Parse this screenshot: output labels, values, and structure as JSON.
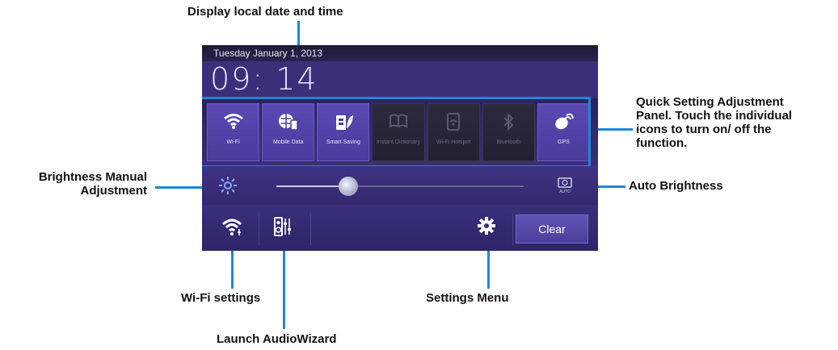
{
  "callouts": {
    "datetime": "Display local date and time",
    "quick_settings": [
      "Quick Setting Adjustment",
      "Panel. Touch the individual",
      "icons to turn on/ off the",
      "function."
    ],
    "brightness_manual": [
      "Brightness Manual",
      "Adjustment"
    ],
    "auto_brightness": "Auto Brightness",
    "wifi_settings": "Wi-Fi settings",
    "settings_menu": "Settings Menu",
    "audiowizard": "Launch AudioWizard"
  },
  "panel": {
    "date": "Tuesday January 1, 2013",
    "time": "09: 14",
    "tiles": [
      {
        "label": "Wi-Fi",
        "icon": "wifi-icon",
        "on": true
      },
      {
        "label": "Mobile Data",
        "icon": "mobile-data-icon",
        "on": true
      },
      {
        "label": "Smart Saving",
        "icon": "smart-saving-icon",
        "on": true
      },
      {
        "label": "Instant Dictionary",
        "icon": "dictionary-icon",
        "on": false
      },
      {
        "label": "Wi-Fi Hotspot",
        "icon": "hotspot-icon",
        "on": false
      },
      {
        "label": "Bluetooth",
        "icon": "bluetooth-icon",
        "on": false
      },
      {
        "label": "GPS",
        "icon": "gps-icon",
        "on": true
      }
    ],
    "brightness_level": 0.29,
    "auto_label": "AUTO",
    "clear_label": "Clear"
  },
  "colors": {
    "accent": "#1e88d6",
    "panel": "#3c2f7a",
    "tile_on": "#5a49b3",
    "tile_off": "#2d2a3e"
  }
}
